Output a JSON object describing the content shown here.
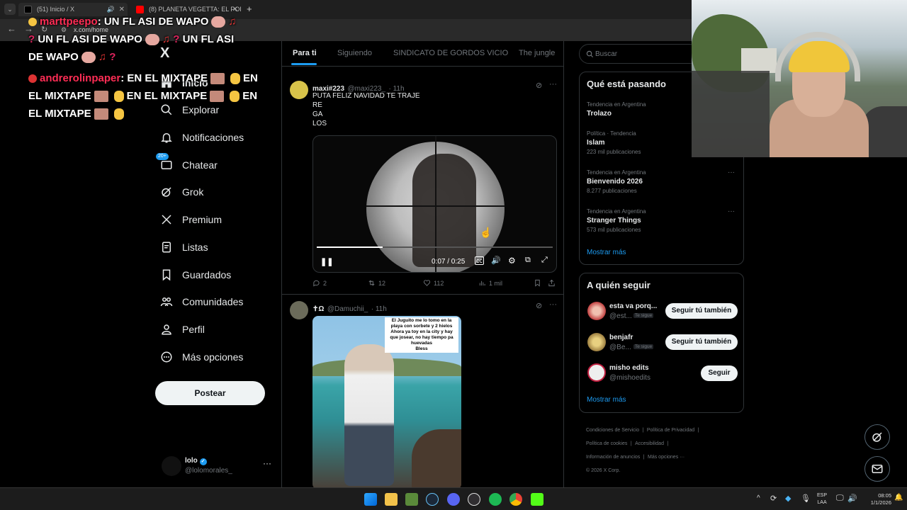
{
  "browser": {
    "tabs": [
      {
        "label": "(51) Inicio / X"
      },
      {
        "label": "(8) PLANETA VEGETTA: EL PORT"
      }
    ],
    "new_tab": "+",
    "url": "x.com/home"
  },
  "chat": {
    "lines": [
      {
        "user": "marttpeepo",
        "text": ": UN FL ASI DE WAPO"
      },
      {
        "text": "UN FL ASI DE WAPO"
      },
      {
        "text": "UN FL ASI"
      },
      {
        "text": "DE WAPO"
      },
      {
        "user": "andrerolinpaper",
        "text": ": EN EL MIXTAPE"
      },
      {
        "text": "EN"
      },
      {
        "text": "EL MIXTAPE"
      },
      {
        "text": "EN EL MIXTAPE"
      },
      {
        "text": "EN EL MIXTAPE"
      },
      {
        "text": "EL MIXTAPE"
      }
    ]
  },
  "nav": {
    "logo": "X",
    "items": [
      {
        "label": "Inicio",
        "icon": "home-icon"
      },
      {
        "label": "Explorar",
        "icon": "search-icon"
      },
      {
        "label": "Notificaciones",
        "icon": "bell-icon"
      },
      {
        "label": "Chatear",
        "icon": "chat-icon",
        "badge": "20+"
      },
      {
        "label": "Grok",
        "icon": "grok-icon"
      },
      {
        "label": "Premium",
        "icon": "x-icon"
      },
      {
        "label": "Listas",
        "icon": "list-icon"
      },
      {
        "label": "Guardados",
        "icon": "bookmark-icon"
      },
      {
        "label": "Comunidades",
        "icon": "people-icon"
      },
      {
        "label": "Perfil",
        "icon": "person-icon"
      },
      {
        "label": "Más opciones",
        "icon": "more-circle-icon"
      }
    ],
    "post_label": "Postear",
    "account": {
      "name": "lolo",
      "handle": "@lolomorales_",
      "more": "···"
    }
  },
  "timeline": {
    "tabs": [
      "Para ti",
      "Siguiendo",
      "SINDICATO DE GORDOS VICIO",
      "The jungle"
    ],
    "tweets": [
      {
        "name": "maxi#223",
        "handle": "@maxi223_",
        "time": "· 11h",
        "text": [
          "PUTA FELIZ NAVIDAD TE TRAJE",
          "RE",
          "GA",
          "LOS"
        ],
        "video_time": "0:07 / 0:25",
        "video_progress": 0.28,
        "replies": "2",
        "reposts": "12",
        "likes": "112",
        "views": "1 mil"
      },
      {
        "name": "✝Ω",
        "handle": "@Damuchii_",
        "time": "· 11h",
        "image_caption": [
          "El Juguito me lo tomo en la",
          "playa con sorbete y 2 hielos",
          "Ahora ya toy en la city y hay",
          "que josear, no hay tiempo pa",
          "huevadas",
          "Bless"
        ]
      }
    ]
  },
  "right": {
    "search_placeholder": "Buscar",
    "trends_title": "Qué está pasando",
    "trends": [
      {
        "category": "Tendencia en Argentina",
        "name": "Trolazo",
        "count": ""
      },
      {
        "category": "Política · Tendencia",
        "name": "Islam",
        "count": "223 mil publicaciones"
      },
      {
        "category": "Tendencia en Argentina",
        "name": "Bienvenido 2026",
        "count": "8.277 publicaciones"
      },
      {
        "category": "Tendencia en Argentina",
        "name": "Stranger Things",
        "count": "573 mil publicaciones"
      }
    ],
    "show_more": "Mostrar más",
    "follow_title": "A quién seguir",
    "follow": [
      {
        "name": "esta va porq...",
        "handle": "@est...",
        "follows_you": "Te sigue",
        "button": "Seguir tú también"
      },
      {
        "name": "benjafr",
        "handle": "@Be...",
        "follows_you": "Te sigue",
        "button": "Seguir tú también"
      },
      {
        "name": "misho edits",
        "handle": "@mishoedits",
        "follows_you": "",
        "button": "Seguir"
      }
    ],
    "footer": [
      "Condiciones de Servicio",
      "|",
      "Política de Privacidad",
      "|",
      "Política de cookies",
      "|",
      "Accesibilidad",
      "|",
      "Información de anuncios",
      "|",
      "Más opciones ···",
      "© 2026 X Corp."
    ]
  },
  "taskbar": {
    "lang": "ESP",
    "lang2": "LAA",
    "time": "08:05",
    "date": "1/1/2026"
  },
  "colors": {
    "accent": "#1d9bf0",
    "background": "#000000",
    "border": "#2f3336",
    "muted": "#71767b"
  }
}
